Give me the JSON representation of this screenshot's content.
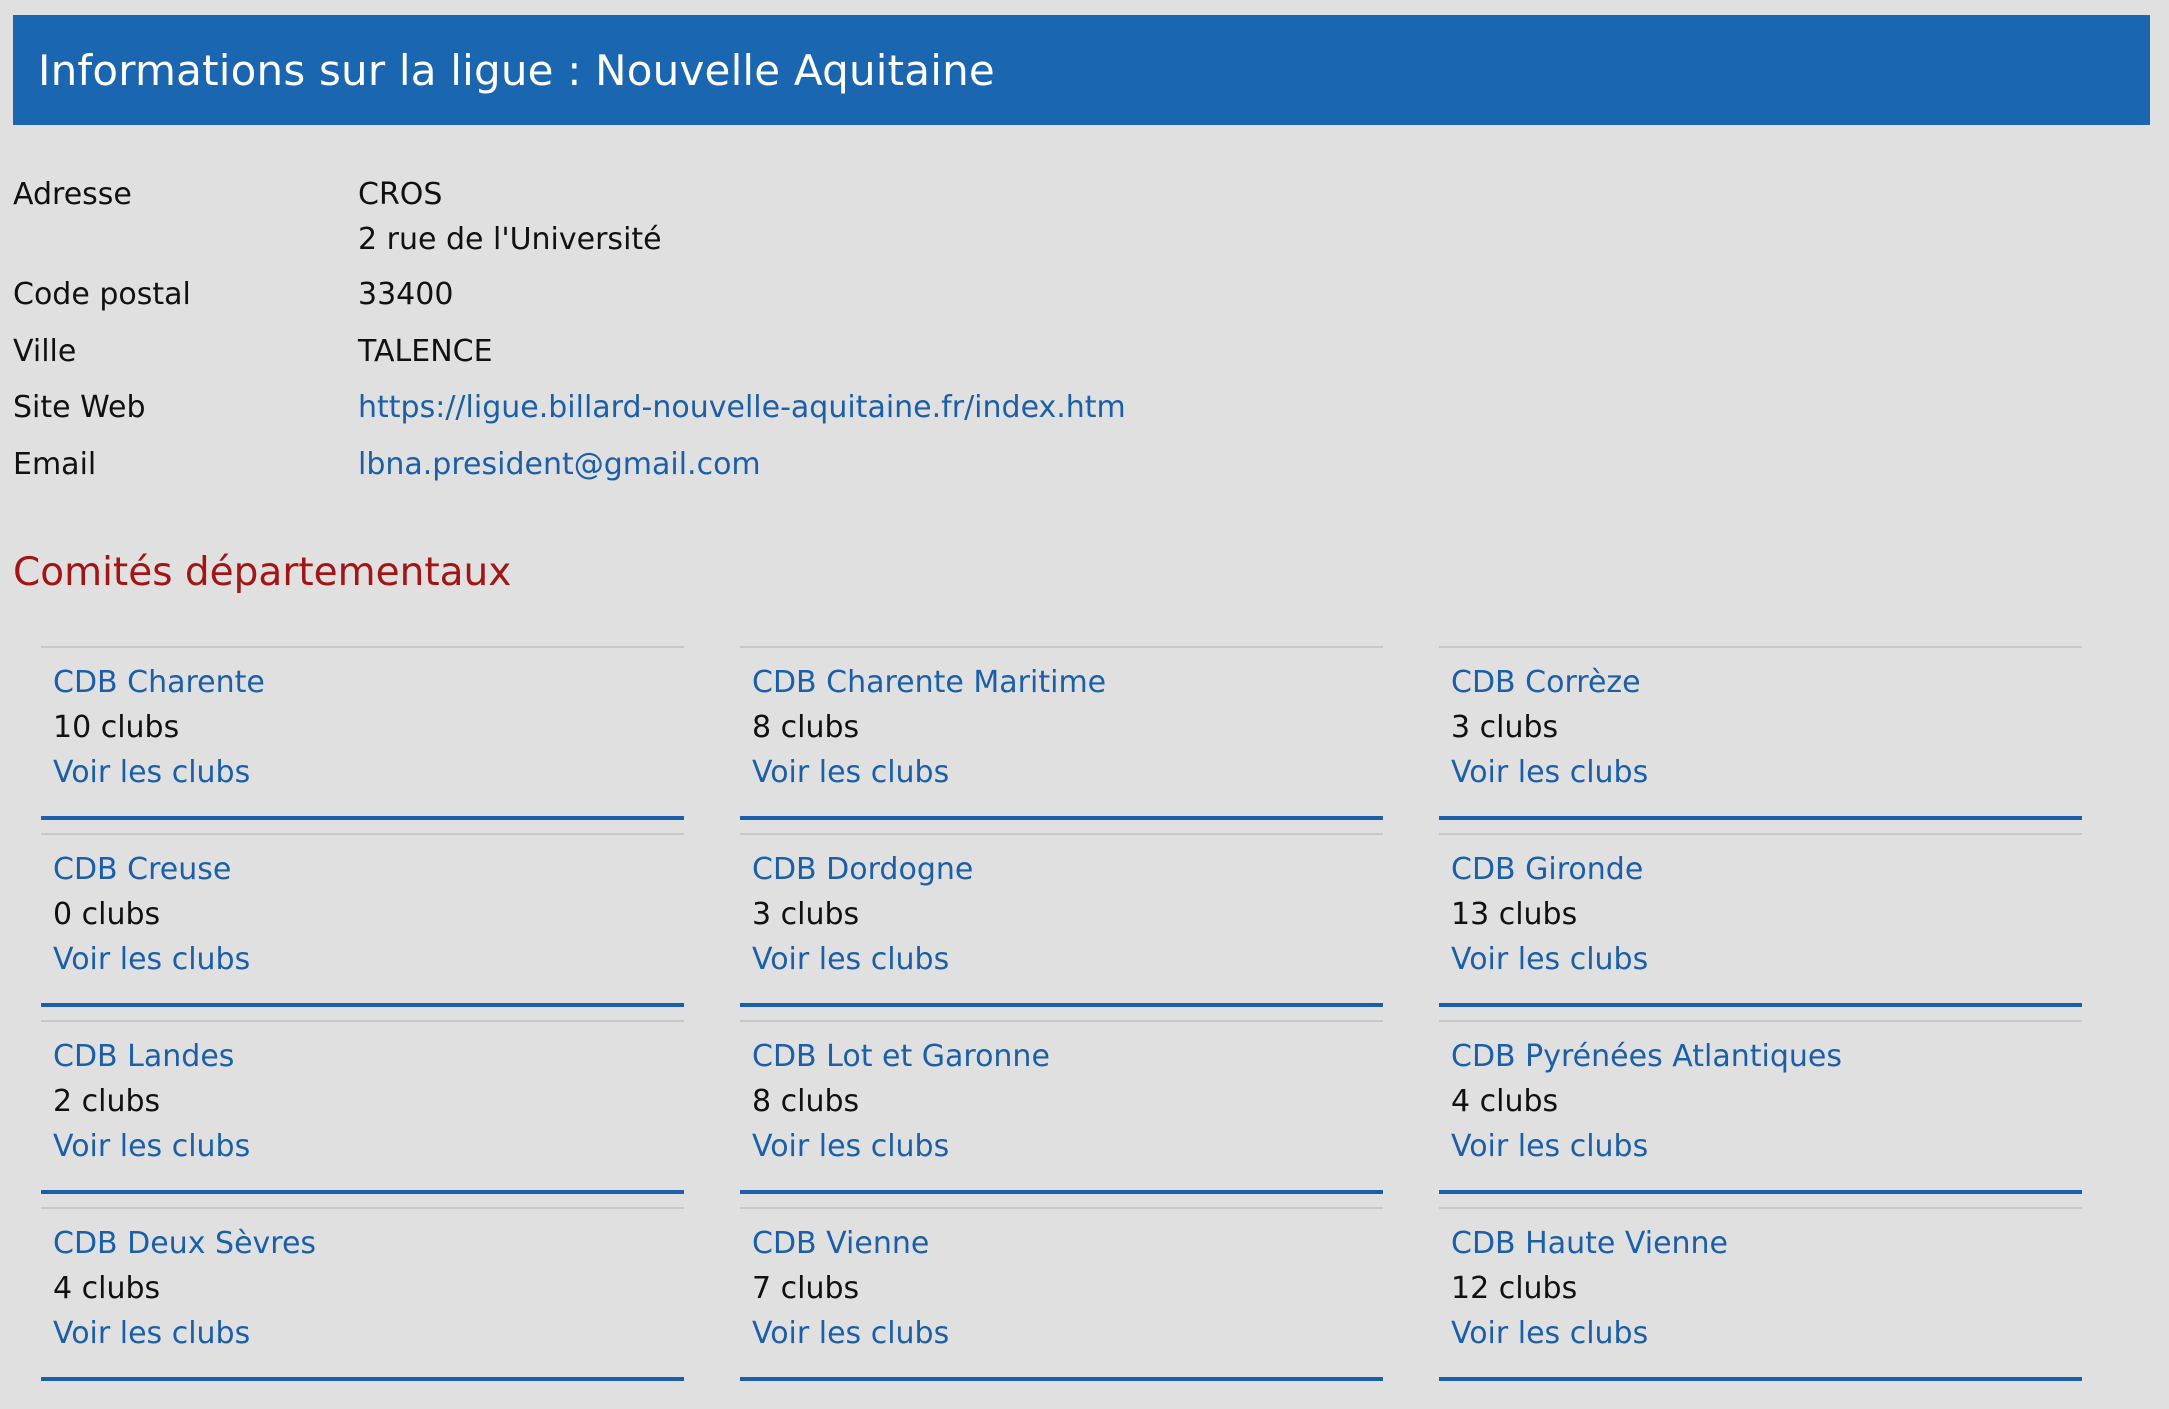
{
  "header": {
    "title": "Informations sur la ligue : Nouvelle Aquitaine"
  },
  "info": {
    "adresse_label": "Adresse",
    "adresse_line1": "CROS",
    "adresse_line2": "2 rue de l'Université",
    "code_postal_label": "Code postal",
    "code_postal_value": "33400",
    "ville_label": "Ville",
    "ville_value": "TALENCE",
    "site_label": "Site Web",
    "site_value": "https://ligue.billard-nouvelle-aquitaine.fr/index.htm",
    "email_label": "Email",
    "email_value": "lbna.president@gmail.com"
  },
  "committees_section": {
    "title": "Comités départementaux",
    "link_label": "Voir les clubs",
    "items": [
      {
        "name": "CDB Charente",
        "count": "10 clubs"
      },
      {
        "name": "CDB Charente Maritime",
        "count": "8 clubs"
      },
      {
        "name": "CDB Corrèze",
        "count": "3 clubs"
      },
      {
        "name": "CDB Creuse",
        "count": "0 clubs"
      },
      {
        "name": "CDB Dordogne",
        "count": "3 clubs"
      },
      {
        "name": "CDB Gironde",
        "count": "13 clubs"
      },
      {
        "name": "CDB Landes",
        "count": "2 clubs"
      },
      {
        "name": "CDB Lot et Garonne",
        "count": "8 clubs"
      },
      {
        "name": "CDB Pyrénées Atlantiques",
        "count": "4 clubs"
      },
      {
        "name": "CDB Deux Sèvres",
        "count": "4 clubs"
      },
      {
        "name": "CDB Vienne",
        "count": "7 clubs"
      },
      {
        "name": "CDB Haute Vienne",
        "count": "12 clubs"
      }
    ]
  },
  "colors": {
    "header_bg": "#1a66b0",
    "link": "#1a5fa8",
    "section_title": "#a31515",
    "page_bg": "#e0e0e0"
  }
}
